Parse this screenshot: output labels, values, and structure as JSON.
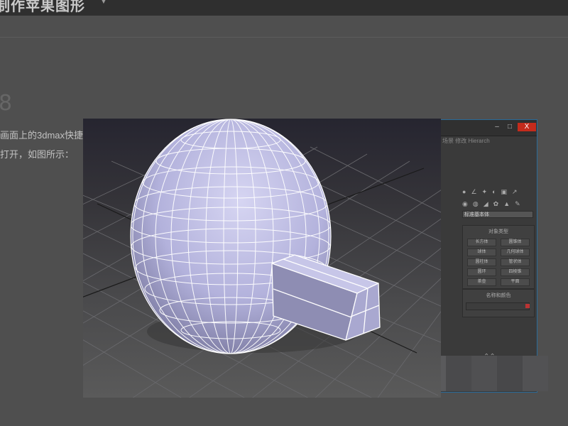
{
  "page": {
    "header_title": "制作苹果图形",
    "header_arrow": "▼",
    "section_number": "8",
    "paragraph_1": "画面上的3dmax快捷",
    "paragraph_2": "打开，如图所示："
  },
  "panel": {
    "close_label": "X",
    "tabs_text": "场景  修改  Hierarch",
    "dropdown_value": "标准基本体",
    "object_type_title": "对象类型",
    "buttons": [
      "长方体",
      "圆锥体",
      "球体",
      "几何球体",
      "圆柱体",
      "管状体",
      "圆环",
      "四棱锥",
      "茶壶",
      "平面"
    ],
    "name_color_title": "名称和颜色"
  },
  "colors": {
    "background": "#4f4f4f",
    "topbar": "#2f2f2f",
    "sphere": "#b8b7e0",
    "box": "#9a99c0",
    "wireframe": "#ffffff",
    "close_button": "#c42b1c"
  },
  "viewport": {
    "view": "perspective",
    "objects": [
      "sphere",
      "box"
    ]
  }
}
